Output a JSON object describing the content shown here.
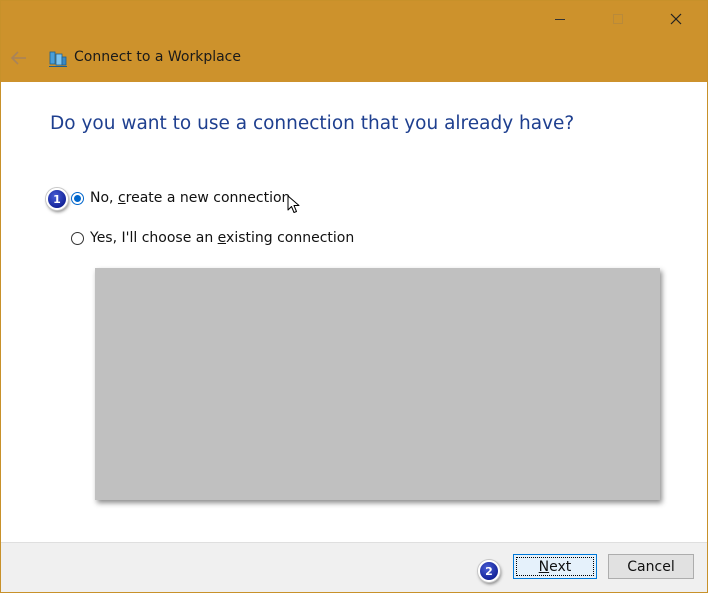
{
  "window": {
    "title": "Connect to a Workplace",
    "titlebar_color": "#cd922c",
    "controls": [
      "minimize-icon",
      "maximize-icon",
      "close-icon"
    ]
  },
  "page": {
    "heading": "Do you want to use a connection that you already have?",
    "options": [
      {
        "pre": "No, ",
        "accel": "c",
        "post": "reate a new connection",
        "selected": true
      },
      {
        "pre": "Yes, I'll choose an ",
        "accel": "e",
        "post": "xisting connection",
        "selected": false
      }
    ]
  },
  "annotations": {
    "marker_1": "1",
    "marker_2": "2"
  },
  "footer": {
    "next_accel": "N",
    "next_rest": "ext",
    "cancel_label": "Cancel"
  }
}
